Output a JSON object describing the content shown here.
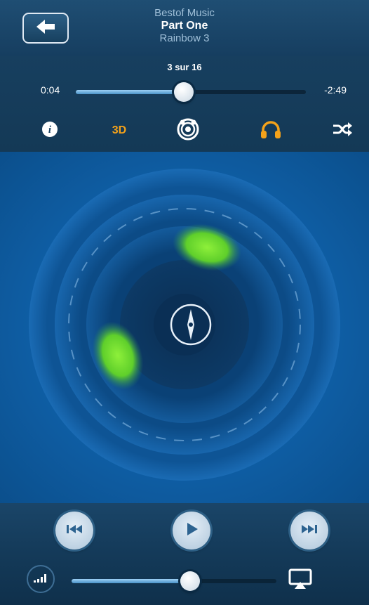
{
  "header": {
    "playlist": "Bestof Music",
    "track_title": "Part One",
    "artist": "Rainbow 3"
  },
  "progress": {
    "track_count": "3 sur 16",
    "elapsed": "0:04",
    "remaining": "-2:49",
    "fraction": 0.47
  },
  "tools": {
    "three_d_label": "3D",
    "info_icon": "info-icon",
    "surround_icon": "surround-icon",
    "headphones_icon": "headphones-icon",
    "shuffle_icon": "shuffle-icon"
  },
  "transport": {
    "prev_icon": "previous-track-icon",
    "play_icon": "play-icon",
    "next_icon": "next-track-icon"
  },
  "volume": {
    "fraction": 0.58,
    "icon": "volume-icon",
    "airplay_icon": "airplay-icon"
  },
  "colors": {
    "accent_orange": "#f4a21a",
    "sound_source_green": "#7ed321",
    "background_blue": "#0f5fa6"
  }
}
